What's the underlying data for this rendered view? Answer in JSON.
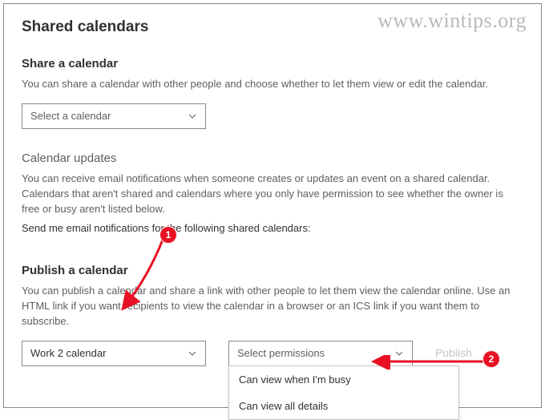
{
  "watermark": "www.wintips.org",
  "page_title": "Shared calendars",
  "share": {
    "title": "Share a calendar",
    "desc": "You can share a calendar with other people and choose whether to let them view or edit the calendar.",
    "select_label": "Select a calendar"
  },
  "updates": {
    "title": "Calendar updates",
    "desc": "You can receive email notifications when someone creates or updates an event on a shared calendar. Calendars that aren't shared and calendars where you only have permission to see whether the owner is free or busy aren't listed below.",
    "send_label": "Send me email notifications for the following shared calendars:"
  },
  "publish": {
    "title": "Publish a calendar",
    "desc": "You can publish a calendar and share a link with other people to let them view the calendar online. Use an HTML link if you want recipients to view the calendar in a browser or an ICS link if you want them to subscribe.",
    "calendar_value": "Work 2 calendar",
    "perm_placeholder": "Select permissions",
    "options": [
      "Can view when I'm busy",
      "Can view all details"
    ],
    "publish_label": "Publish"
  },
  "annotations": {
    "b1": "1",
    "b2": "2"
  }
}
